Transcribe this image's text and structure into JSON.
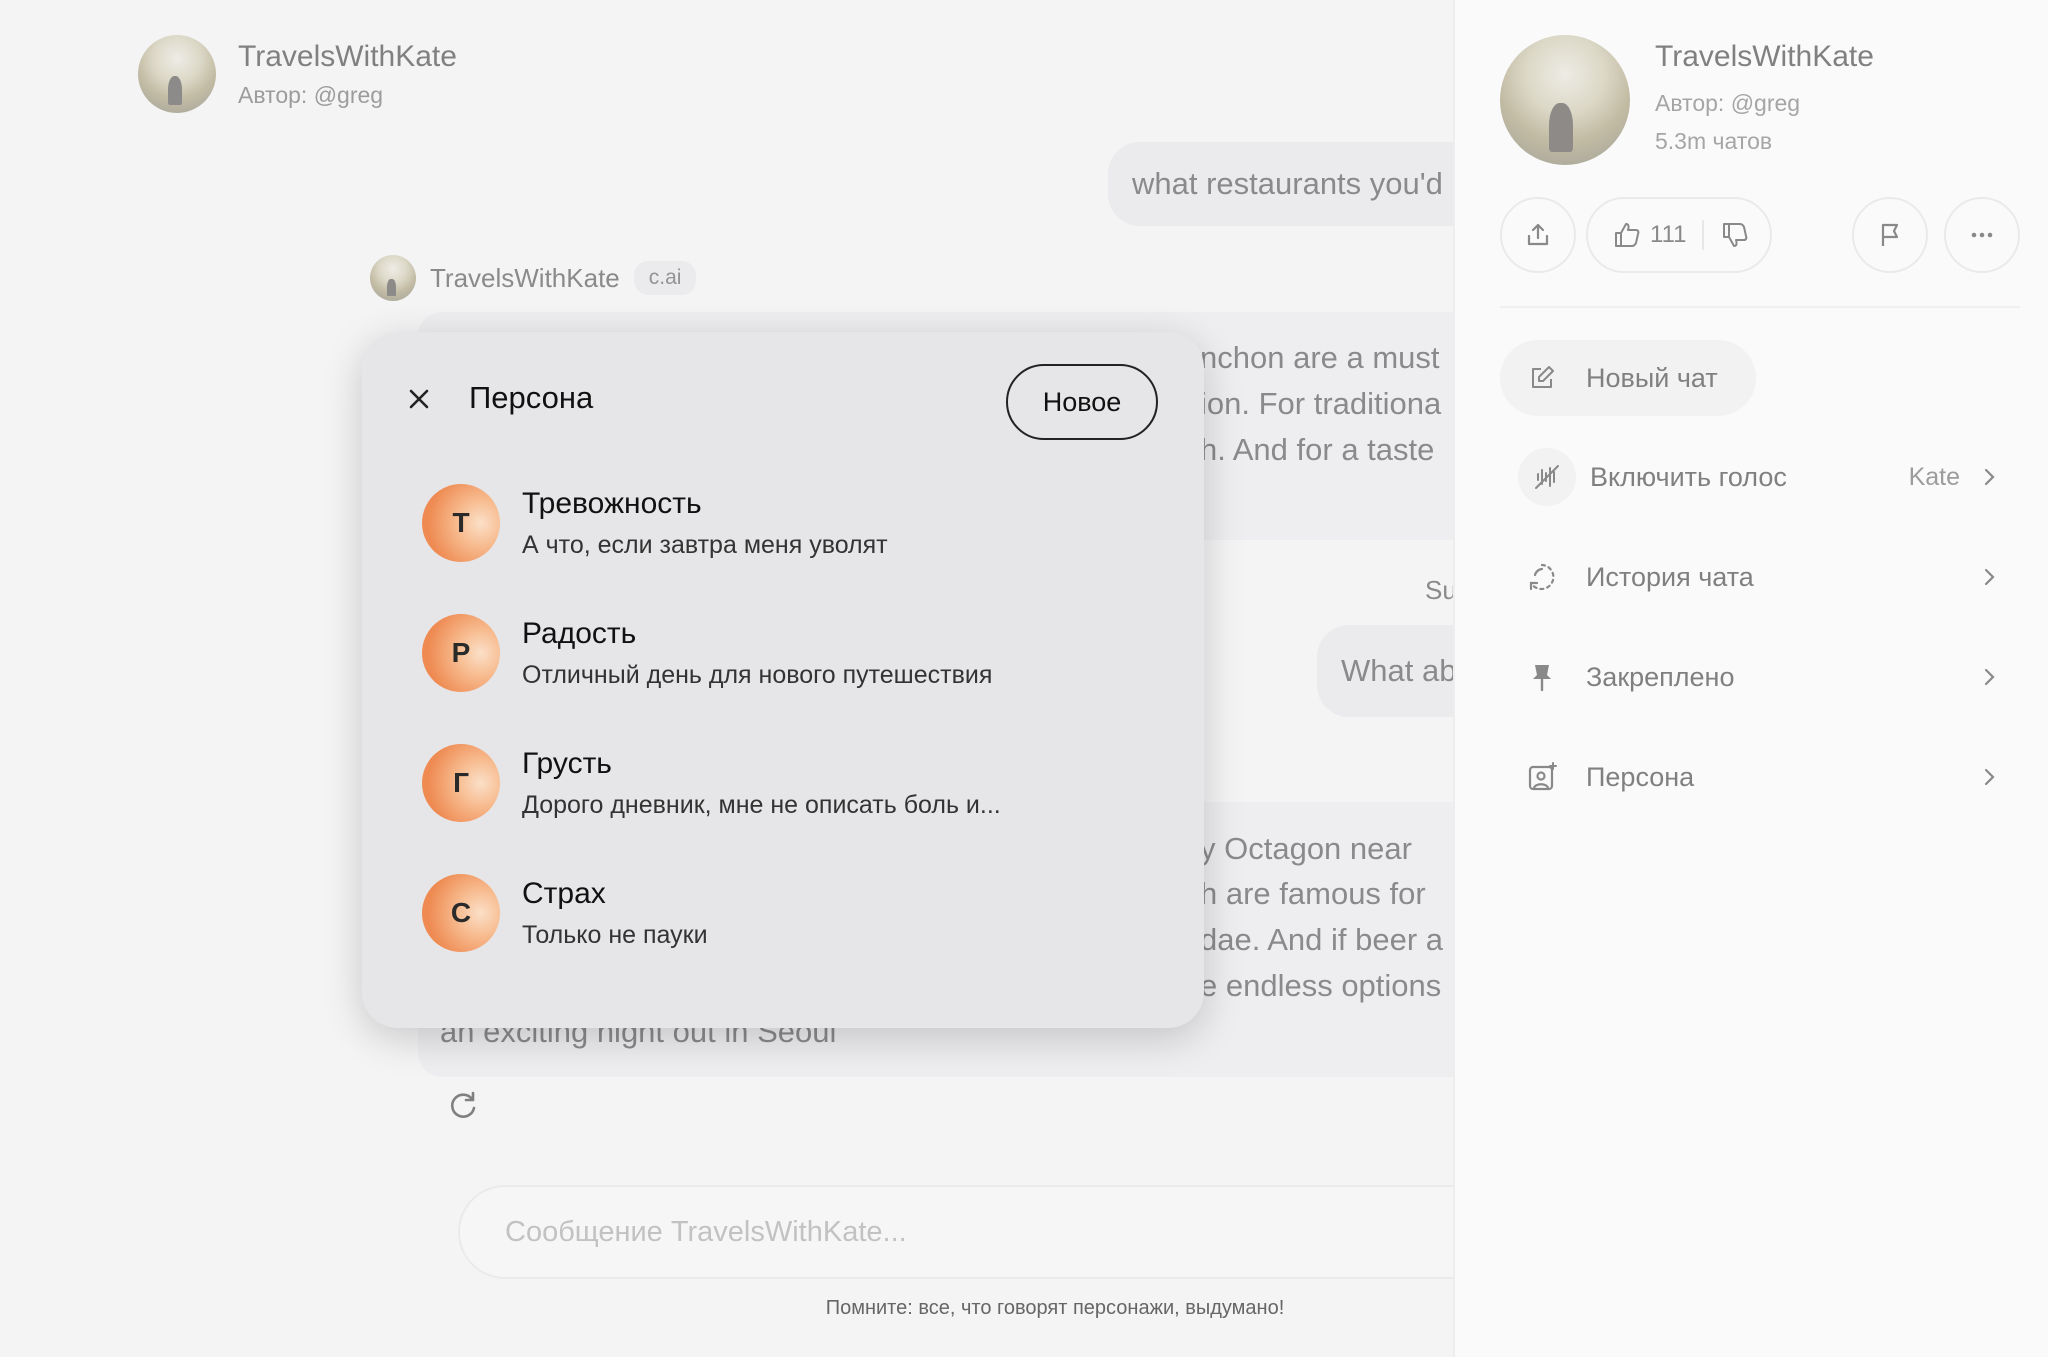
{
  "header": {
    "name": "TravelsWithKate",
    "author": "Автор: @greg"
  },
  "chat": {
    "user_msg_1": "what restaurants you'd",
    "bot_name": "TravelsWithKate",
    "bot_tag": "c.ai",
    "bot_msg_1_lines": [
      "nchon are a must",
      "ion. For traditiona",
      "h. And for a taste"
    ],
    "swipe_label": "Su",
    "user_msg_2": "What ab",
    "bot_msg_2_lines": [
      "y Octagon near",
      "h are famous for",
      "dae. And if beer a",
      "e endless options"
    ],
    "bot_msg_2_last": "an exciting night out in Seoul"
  },
  "input": {
    "placeholder": "Сообщение TravelsWithKate..."
  },
  "footer": {
    "note": "Помните: все, что говорят персонажи, выдумано!"
  },
  "persona_popup": {
    "title": "Персона",
    "new_button": "Новое",
    "items": [
      {
        "initial": "Т",
        "name": "Тревожность",
        "desc": "А что, если завтра меня уволят"
      },
      {
        "initial": "Р",
        "name": "Радость",
        "desc": "Отличный день для нового путешествия"
      },
      {
        "initial": "Г",
        "name": "Грусть",
        "desc": "Дорого дневник, мне не описать боль и..."
      },
      {
        "initial": "С",
        "name": "Страх",
        "desc": "Только не пауки"
      }
    ]
  },
  "sidebar": {
    "name": "TravelsWithKate",
    "author": "Автор: @greg",
    "chats": "5.3m чатов",
    "likes": "111",
    "menu": {
      "new_chat": "Новый чат",
      "voice": "Включить голос",
      "voice_value": "Kate",
      "history": "История чата",
      "pinned": "Закреплено",
      "persona": "Персона"
    }
  },
  "colors": {
    "persona_avatar": "#ee8a52",
    "background": "#f4f4f5",
    "popup": "#e6e6e8"
  }
}
